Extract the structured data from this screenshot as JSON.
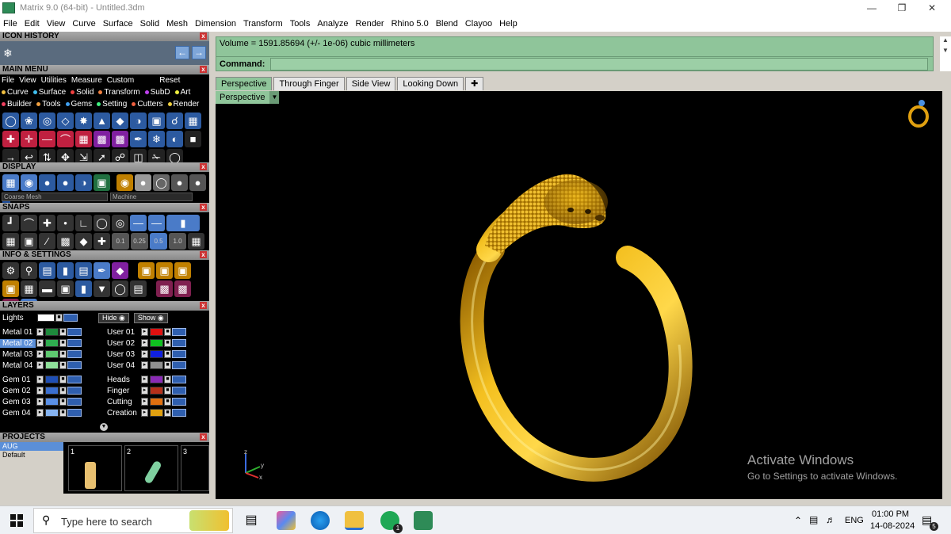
{
  "window": {
    "title": "Matrix 9.0 (64-bit) - Untitled.3dm",
    "controls": [
      "minimize-icon",
      "restore-icon",
      "close-icon"
    ]
  },
  "menubar": [
    "File",
    "Edit",
    "View",
    "Curve",
    "Surface",
    "Solid",
    "Mesh",
    "Dimension",
    "Transform",
    "Tools",
    "Analyze",
    "Render",
    "Rhino 5.0",
    "Blend",
    "Clayoo",
    "Help"
  ],
  "left": {
    "icon_history": "ICON HISTORY",
    "main_menu": "MAIN MENU",
    "main_menu_row1": [
      "File",
      "View",
      "Utilities",
      "Measure",
      "Custom"
    ],
    "main_menu_reset": "Reset",
    "main_menu_row2": [
      "Curve",
      "Surface",
      "Solid",
      "Transform",
      "SubD",
      "Art"
    ],
    "main_menu_row3": [
      "Builder",
      "Tools",
      "Gems",
      "Setting",
      "Cutters",
      "Render"
    ],
    "display": "DISPLAY",
    "display_mode": "Coarse Mesh",
    "display_material": "Machine",
    "snaps": "SNAPS",
    "snap_values": [
      "0.1",
      "0.25",
      "0.5",
      "1.0"
    ],
    "info_settings": "INFO & SETTINGS",
    "layers": "LAYERS",
    "lights": "Lights",
    "hide": "Hide",
    "show": "Show",
    "layers_left": [
      {
        "name": "Metal 01",
        "color": "#1e8a3c"
      },
      {
        "name": "Metal 02",
        "color": "#2fae50"
      },
      {
        "name": "Metal 03",
        "color": "#5ec970"
      },
      {
        "name": "Metal 04",
        "color": "#8fe09a"
      },
      {
        "name": "Gem 01",
        "color": "#1f4fb5"
      },
      {
        "name": "Gem 02",
        "color": "#3a6fd0"
      },
      {
        "name": "Gem 03",
        "color": "#5a90e6"
      },
      {
        "name": "Gem 04",
        "color": "#86b4f2"
      }
    ],
    "layers_right": [
      {
        "name": "User 01",
        "color": "#e01010"
      },
      {
        "name": "User 02",
        "color": "#10c020"
      },
      {
        "name": "User 03",
        "color": "#1020e0"
      },
      {
        "name": "User 04",
        "color": "#909090"
      },
      {
        "name": "Heads",
        "color": "#8a2ab5"
      },
      {
        "name": "Finger",
        "color": "#b5301a"
      },
      {
        "name": "Cutting",
        "color": "#e07010"
      },
      {
        "name": "Creation",
        "color": "#e0a010"
      }
    ],
    "projects": "PROJECTS",
    "project_items": [
      "AUG",
      "Default"
    ],
    "project_thumbs": [
      "1",
      "2",
      "3"
    ]
  },
  "command": {
    "output": "Volume = 1591.85694 (+/- 1e-06) cubic millimeters",
    "label": "Command:",
    "value": ""
  },
  "tabs": [
    "Perspective",
    "Through Finger",
    "Side View",
    "Looking Down"
  ],
  "viewport": {
    "label": "Perspective",
    "axes": [
      "z",
      "y",
      "x"
    ],
    "watermark_title": "Activate Windows",
    "watermark_sub": "Go to Settings to activate Windows."
  },
  "taskbar": {
    "search_placeholder": "Type here to search",
    "whatsapp_badge": "1",
    "lang": "ENG",
    "time": "01:00 PM",
    "date": "14-08-2024",
    "notifications": "5"
  }
}
